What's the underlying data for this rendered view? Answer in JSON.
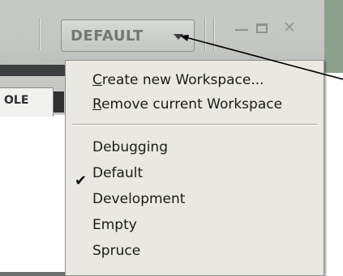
{
  "toolbar": {
    "workspace_label": "DEFAULT",
    "minimize_glyph": "—",
    "close_glyph": "×"
  },
  "tabs": {
    "console_label": "OLE"
  },
  "workspace_menu": {
    "actions": [
      {
        "mnemonic": "C",
        "rest": "reate new Workspace..."
      },
      {
        "mnemonic": "R",
        "rest": "emove current Workspace"
      }
    ],
    "workspaces": [
      {
        "label": "Debugging",
        "checked": false
      },
      {
        "label": "Default",
        "checked": true
      },
      {
        "label": "Development",
        "checked": false
      },
      {
        "label": "Empty",
        "checked": false
      },
      {
        "label": "Spruce",
        "checked": false
      }
    ],
    "check_glyph": "✔"
  },
  "colors": {
    "titlebar": "#c4c6c3",
    "menu_background": "#e9e8e1",
    "accent_strip": "#8d9f8d"
  }
}
